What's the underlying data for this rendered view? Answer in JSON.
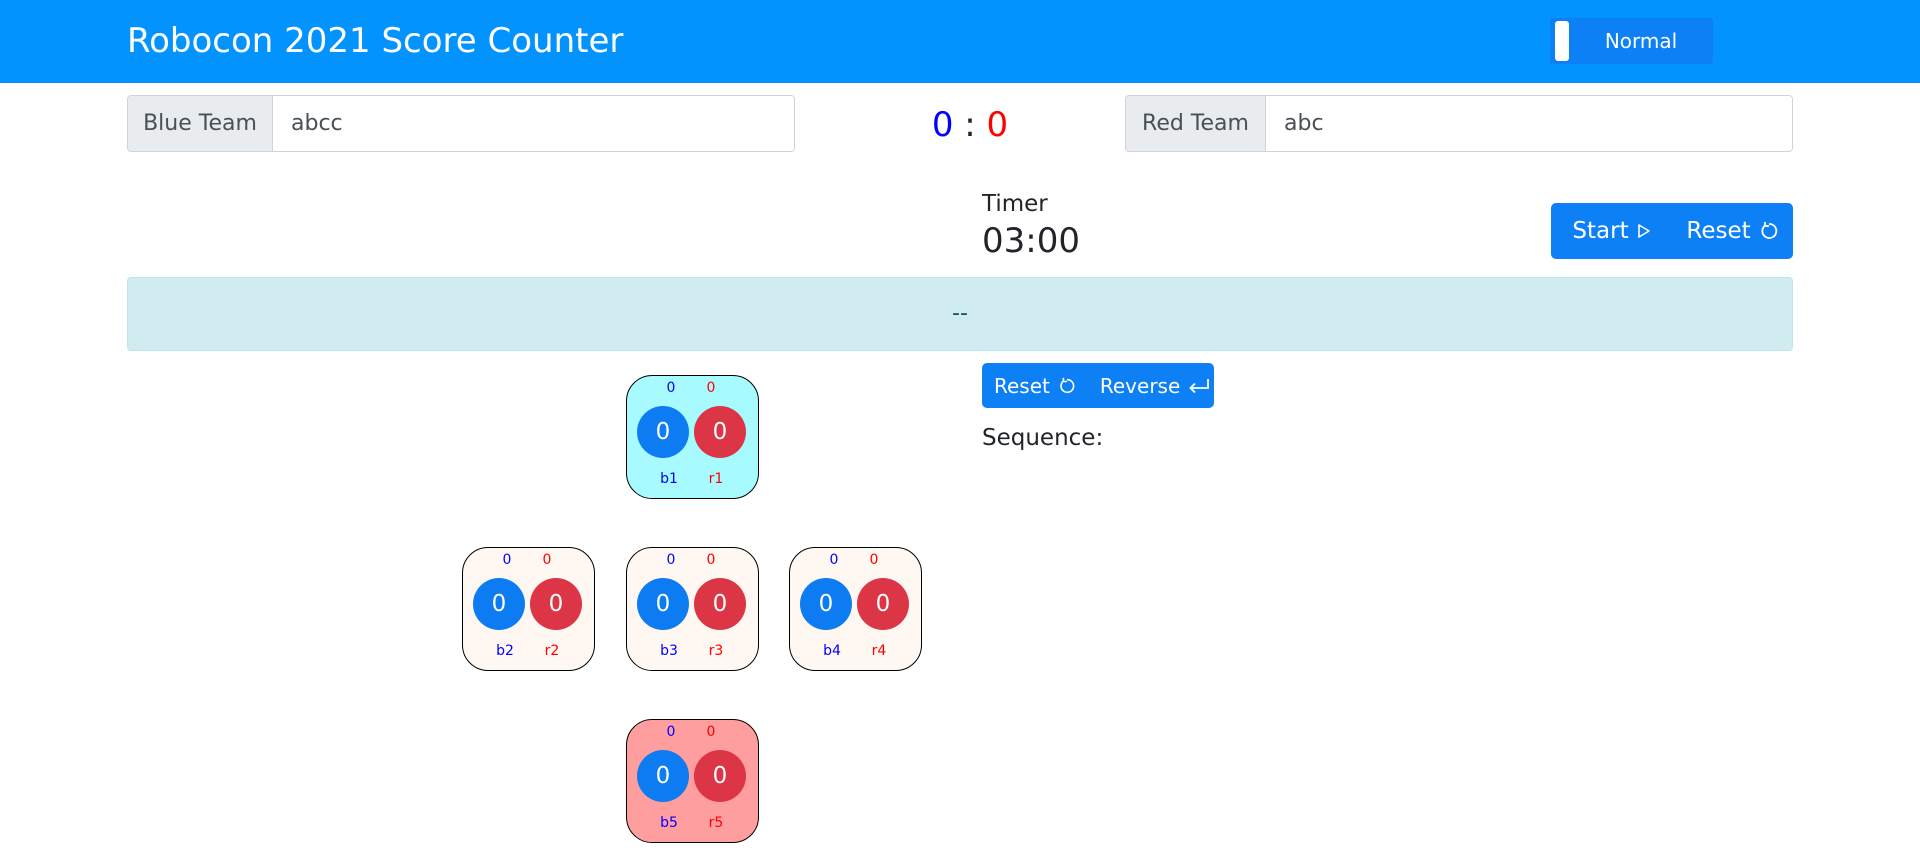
{
  "header": {
    "title": "Robocon 2021 Score Counter",
    "mode_label": "Normal"
  },
  "blue_team": {
    "addon": "Blue Team",
    "value": "abcc"
  },
  "red_team": {
    "addon": "Red Team",
    "value": "abc"
  },
  "scoreboard": {
    "blue": "0",
    "separator": ":",
    "red": "0"
  },
  "timer": {
    "label": "Timer",
    "value": "03:00",
    "start_label": "Start",
    "reset_label": "Reset"
  },
  "status": {
    "text": "--"
  },
  "sequence": {
    "reset_label": "Reset",
    "reverse_label": "Reverse",
    "label": "Sequence:"
  },
  "colors": {
    "header": "#0393ff",
    "primary": "#0d80f5",
    "blue_ball": "#0d7cf2",
    "red_ball": "#dc3545",
    "status_bg": "#d1ecf1",
    "pot_cyan": "#a7fbff",
    "pot_cream": "#fff8f2",
    "pot_pink": "#ff9e9e"
  },
  "pots": [
    {
      "blue_count": "0",
      "red_count": "0",
      "blue_score": "0",
      "red_score": "0",
      "blue_name": "b1",
      "red_name": "r1"
    },
    {
      "blue_count": "0",
      "red_count": "0",
      "blue_score": "0",
      "red_score": "0",
      "blue_name": "b2",
      "red_name": "r2"
    },
    {
      "blue_count": "0",
      "red_count": "0",
      "blue_score": "0",
      "red_score": "0",
      "blue_name": "b3",
      "red_name": "r3"
    },
    {
      "blue_count": "0",
      "red_count": "0",
      "blue_score": "0",
      "red_score": "0",
      "blue_name": "b4",
      "red_name": "r4"
    },
    {
      "blue_count": "0",
      "red_count": "0",
      "blue_score": "0",
      "red_score": "0",
      "blue_name": "b5",
      "red_name": "r5"
    }
  ]
}
